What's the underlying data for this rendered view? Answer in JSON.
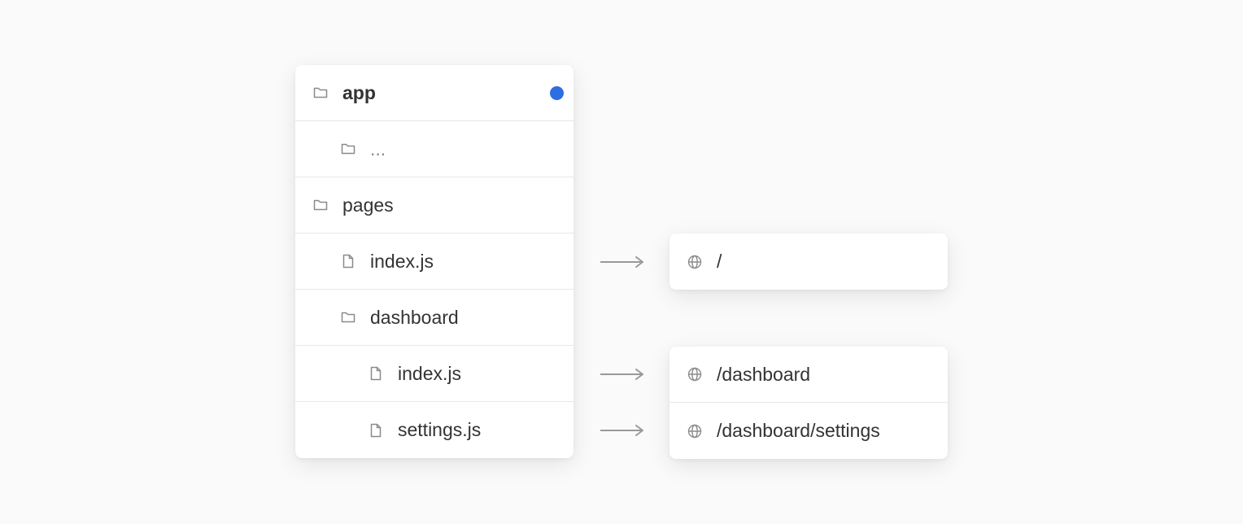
{
  "colors": {
    "accent_dot": "#2d6ee0",
    "text": "#333333",
    "muted_text": "#8c8c8c",
    "icon_stroke": "#8a8a8a",
    "arrow": "#999999"
  },
  "file_tree": {
    "items": [
      {
        "label": "app",
        "icon": "folder-icon",
        "depth": 0,
        "bold": true,
        "dot": true
      },
      {
        "label": "...",
        "icon": "folder-icon",
        "depth": 1,
        "muted": true
      },
      {
        "label": "pages",
        "icon": "folder-icon",
        "depth": 0
      },
      {
        "label": "index.js",
        "icon": "file-icon",
        "depth": 1
      },
      {
        "label": "dashboard",
        "icon": "folder-icon",
        "depth": 1
      },
      {
        "label": "index.js",
        "icon": "file-icon",
        "depth": 2
      },
      {
        "label": "settings.js",
        "icon": "file-icon",
        "depth": 2
      }
    ]
  },
  "routes": {
    "root": {
      "label": "/",
      "icon": "globe-icon"
    },
    "dashboard": [
      {
        "label": "/dashboard",
        "icon": "globe-icon"
      },
      {
        "label": "/dashboard/settings",
        "icon": "globe-icon"
      }
    ]
  },
  "arrows": [
    {
      "from": "file_tree.items.3",
      "to": "routes.root"
    },
    {
      "from": "file_tree.items.5",
      "to": "routes.dashboard.0"
    },
    {
      "from": "file_tree.items.6",
      "to": "routes.dashboard.1"
    }
  ]
}
